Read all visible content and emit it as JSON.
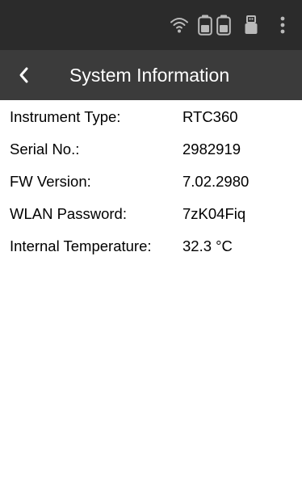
{
  "status_bar": {
    "icons": [
      "wifi-icon",
      "battery-icon",
      "battery-icon",
      "usb-icon",
      "more-vert-icon"
    ],
    "background": "#2b2b2b",
    "icon_color": "#b9b9b9"
  },
  "header": {
    "title": "System Information",
    "background": "#3b3b3b",
    "back_icon": "chevron-left-icon"
  },
  "info": [
    {
      "label": "Instrument Type:",
      "value": "RTC360"
    },
    {
      "label": "Serial No.:",
      "value": "2982919"
    },
    {
      "label": "FW Version:",
      "value": "7.02.2980"
    },
    {
      "label": "WLAN Password:",
      "value": "7zK04Fiq"
    },
    {
      "label": "Internal Temperature:",
      "value": "32.3 °C"
    }
  ]
}
